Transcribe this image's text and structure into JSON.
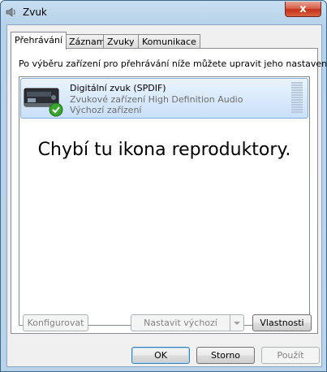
{
  "window": {
    "title": "Zvuk",
    "close_label": "x"
  },
  "tabs": [
    {
      "label": "Přehrávání",
      "active": true
    },
    {
      "label": "Záznam"
    },
    {
      "label": "Zvuky"
    },
    {
      "label": "Komunikace"
    }
  ],
  "playback": {
    "description": "Po výběru zařízení pro přehrávání níže můžete upravit jeho nastavení:",
    "device": {
      "name": "Digitální zvuk (SPDIF)",
      "description": "Zvukové zařízení High Definition Audio",
      "status": "Výchozí zařízení",
      "icon": "digital-audio-device-icon",
      "default_check_icon": "green-checkmark-icon"
    },
    "annotation": "Chybí tu ikona reproduktory."
  },
  "panel_buttons": {
    "configure": "Konfigurovat",
    "set_default": "Nastavit výchozí",
    "properties": "Vlastnosti"
  },
  "dialog_buttons": {
    "ok": "OK",
    "cancel": "Storno",
    "apply": "Použít"
  }
}
